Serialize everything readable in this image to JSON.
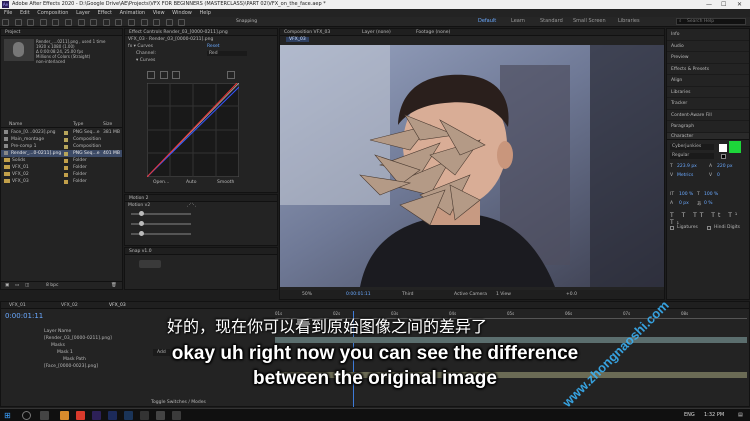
{
  "window": {
    "title": "Adobe After Effects 2020 - D:\\Google Drive\\AE\\Projects\\VFX FOR BEGINNERS (MASTERCLASS)\\PART 02\\VFX_on_the_face.aep *",
    "minimize": "—",
    "maximize": "☐",
    "close": "✕"
  },
  "menu": [
    "File",
    "Edit",
    "Composition",
    "Layer",
    "Effect",
    "Animation",
    "View",
    "Window",
    "Help"
  ],
  "toolbar": {
    "snapping": "Snapping"
  },
  "workspaces": [
    "Default",
    "Learn",
    "Standard",
    "Small Screen",
    "Libraries"
  ],
  "search": {
    "placeholder": "Search Help"
  },
  "project": {
    "tab": "Project",
    "info_name": "Render_....0211].png , used 1 time",
    "info_size": "1920 x 1080 (1.00)",
    "info_dur": "Δ 0:00:08:24, 25.00 fps",
    "info_colors": "Millions of Colors (Straight)",
    "info_int": "non-interlaced",
    "col_name": "Name",
    "col_type": "Type",
    "col_size": "Size",
    "items": [
      {
        "name": "Face_[0...0023].png",
        "type": "PNG Seq...e",
        "size": "381 MB",
        "color": "#b7a55b"
      },
      {
        "name": "Main_montage",
        "type": "Composition",
        "size": "",
        "color": "#b7a55b"
      },
      {
        "name": "Pre-comp 1",
        "type": "Composition",
        "size": "",
        "color": "#b7a55b"
      },
      {
        "name": "Render_...0-0211].png",
        "type": "PNG Seq...e",
        "size": "401 MB",
        "color": "#b7a55b"
      },
      {
        "name": "Solids",
        "type": "Folder",
        "size": "",
        "color": "#c2a04a"
      },
      {
        "name": "VFX_01",
        "type": "Folder",
        "size": "",
        "color": "#c2a04a"
      },
      {
        "name": "VFX_02",
        "type": "Folder",
        "size": "",
        "color": "#c2a04a"
      },
      {
        "name": "VFX_03",
        "type": "Folder",
        "size": "",
        "color": "#c2a04a"
      }
    ],
    "bpc": "8 bpc"
  },
  "effect_controls": {
    "tab": "Effect Controls Render_03_[0000-0211].png",
    "layer_path": "VFX_03 · Render_03_[0000-0211].png",
    "fx_name": "Curves",
    "reset": "Reset",
    "channel_label": "Channel:",
    "channel_value": "Red",
    "curves_label": "Curves",
    "open": "Open...",
    "auto": "Auto",
    "smooth": "Smooth",
    "motion2_tab": "Motion 2",
    "motion_version": "Motion v2",
    "snap_tab": "Snap v1.0"
  },
  "composition": {
    "tab": "Composition VFX_03",
    "comp_name": "VFX_03",
    "layer_tab": "Layer (none)",
    "footage_tab": "Footage (none)",
    "zoom": "50%",
    "timecode": "0:00:01:11",
    "quality": "Third",
    "camera": "Active Camera",
    "view": "1 View",
    "exposure": "+0.0"
  },
  "right_panel": {
    "items": [
      "Info",
      "Audio",
      "Preview",
      "Effects & Presets",
      "Align",
      "Libraries",
      "Tracker",
      "Content-Aware Fill",
      "Paragraph"
    ],
    "character_tab": "Character",
    "font": "Cyberjunkies",
    "style": "Regular",
    "size": "223.9 px",
    "leading": "220 px",
    "kerning": "Metrics",
    "tracking": "0",
    "vert_scale": "100 %",
    "horiz_scale": "100 %",
    "baseline": "0 px",
    "tsume": "0 %",
    "ligatures": "Ligatures",
    "hindi": "Hindi Digits"
  },
  "timeline": {
    "tabs": [
      "VFX_01",
      "VFX_02",
      "VFX_03"
    ],
    "timecode": "0:00:01:11",
    "ruler": [
      "01s",
      "02s",
      "03s",
      "04s",
      "05s",
      "06s",
      "07s",
      "08s"
    ],
    "layers": [
      {
        "num": "",
        "name": "Layer Name"
      },
      {
        "num": "1",
        "name": "[Render_03_[0000-0211].png]"
      },
      {
        "num": "",
        "name": "Masks"
      },
      {
        "num": "",
        "name": "Mask 1"
      },
      {
        "num": "",
        "name": "Mask Path"
      },
      {
        "num": "2",
        "name": "[Face_[0000-0023].png]"
      }
    ],
    "mode_add": "Add",
    "toggle": "Toggle Switches / Modes"
  },
  "subtitles": {
    "cn": "好的，现在你可以看到原始图像之间的差异了",
    "en_line1": "okay uh right now you can see the difference",
    "en_line2": "between the original image"
  },
  "watermark": "www.zhongnaoshi.com",
  "taskbar": {
    "time": "1:32 PM",
    "lang": "ENG"
  },
  "colors": {
    "accent": "#6aa9ff",
    "watermark": "#3ab7ff",
    "character_green": "#1dd63a"
  }
}
